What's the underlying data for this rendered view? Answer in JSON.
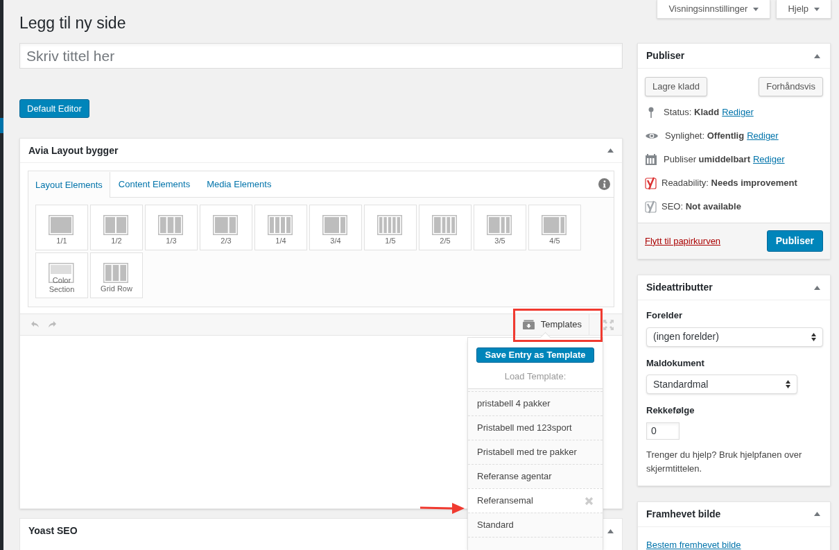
{
  "top_buttons": [
    {
      "label": "Visningsinnstillinger"
    },
    {
      "label": "Hjelp"
    }
  ],
  "page_title": "Legg til ny side",
  "title_field": {
    "placeholder": "Skriv tittel her"
  },
  "default_editor_button": "Default Editor",
  "builder": {
    "title": "Avia Layout bygger",
    "tabs": [
      {
        "label": "Layout Elements",
        "selected": true
      },
      {
        "label": "Content Elements",
        "selected": false
      },
      {
        "label": "Media Elements",
        "selected": false
      }
    ],
    "elements": [
      {
        "label": "1/1",
        "kind": "full"
      },
      {
        "label": "1/2",
        "kind": "half"
      },
      {
        "label": "1/3",
        "kind": "third"
      },
      {
        "label": "2/3",
        "kind": "twothirds"
      },
      {
        "label": "1/4",
        "kind": "quarter"
      },
      {
        "label": "3/4",
        "kind": "threequarters"
      },
      {
        "label": "1/5",
        "kind": "fifth"
      },
      {
        "label": "2/5",
        "kind": "twofifths"
      },
      {
        "label": "3/5",
        "kind": "threefifths"
      },
      {
        "label": "4/5",
        "kind": "fourfifths"
      },
      {
        "label": "Color Section",
        "kind": "section"
      },
      {
        "label": "Grid Row",
        "kind": "gridrow"
      }
    ],
    "templates_button": "Templates",
    "templates_menu": {
      "save_button": "Save Entry as Template",
      "load_label": "Load Template:",
      "items": [
        {
          "label": "pristabell 4 pakker",
          "hovered": false
        },
        {
          "label": "Pristabell med 123sport",
          "hovered": false
        },
        {
          "label": "Pristabell med tre pakker",
          "hovered": false
        },
        {
          "label": "Referanse agentar",
          "hovered": false
        },
        {
          "label": "Referansemal",
          "hovered": true
        },
        {
          "label": "Standard",
          "hovered": false
        }
      ]
    }
  },
  "yoast_box": {
    "title": "Yoast SEO"
  },
  "publish_box": {
    "title": "Publiser",
    "save_draft": "Lagre kladd",
    "preview": "Forhåndsvis",
    "rows": [
      {
        "kind": "pin",
        "label": "Status:",
        "value": "Kladd",
        "link": "Rediger"
      },
      {
        "kind": "eye",
        "label": "Synlighet:",
        "value": "Offentlig",
        "link": "Rediger"
      },
      {
        "kind": "calendar",
        "label": "Publiser",
        "value": "umiddelbart",
        "link": "Rediger"
      },
      {
        "kind": "yoast",
        "label": "Readability:",
        "value": "Needs improvement",
        "color": "#dc3232"
      },
      {
        "kind": "yoast",
        "label": "SEO:",
        "value": "Not available",
        "color": "#a0a5aa"
      }
    ],
    "trash_link": "Flytt til papirkurven",
    "publish_button": "Publiser"
  },
  "attributes_box": {
    "title": "Sideattributter",
    "parent_label": "Forelder",
    "parent_value": "(ingen forelder)",
    "template_label": "Maldokument",
    "template_value": "Standardmal",
    "order_label": "Rekkefølge",
    "order_value": "0",
    "help": "Trenger du hjelp? Bruk hjelpfanen over skjermtittelen."
  },
  "featured_box": {
    "title": "Framhevet bilde",
    "link": "Bestem fremhevet bilde"
  }
}
